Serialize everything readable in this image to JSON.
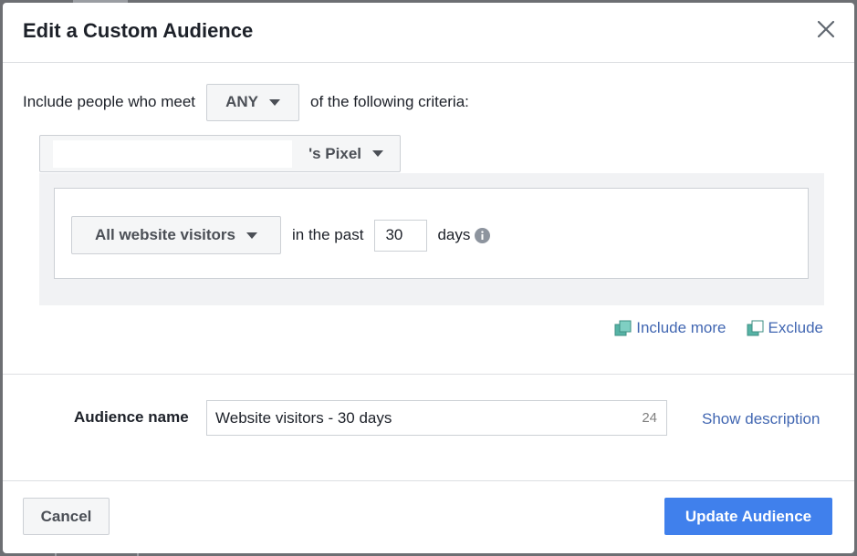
{
  "dialog": {
    "title": "Edit a Custom Audience"
  },
  "rule": {
    "prefix": "Include people who meet",
    "match_value": "ANY",
    "suffix": "of the following criteria:",
    "source_label": "'s Pixel"
  },
  "criteria": {
    "visitors_option": "All website visitors",
    "in_past_label": "in the past",
    "days_value": "30",
    "days_label": "days"
  },
  "actions": {
    "include_more": "Include more",
    "exclude": "Exclude"
  },
  "audience": {
    "name_label": "Audience name",
    "name_value": "Website visitors - 30 days",
    "char_count": "24",
    "show_description": "Show description"
  },
  "footer": {
    "cancel": "Cancel",
    "update": "Update Audience"
  },
  "colors": {
    "accent": "#4080ec",
    "link": "#4267b2",
    "icon_teal": "#56b3a5"
  }
}
